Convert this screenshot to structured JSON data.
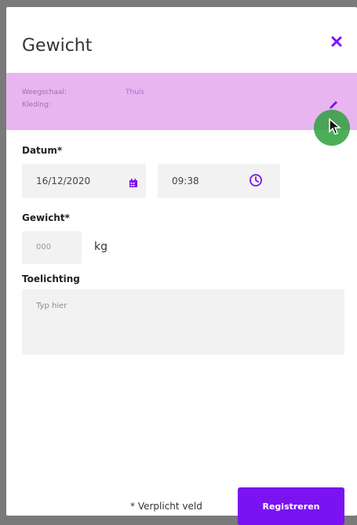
{
  "dialog": {
    "title": "Gewicht",
    "close_icon": "close-icon"
  },
  "info": {
    "scale_label": "Weegschaal:",
    "scale_value": "Thuis",
    "clothing_label": "Kleding:",
    "edit_icon": "pencil-icon"
  },
  "form": {
    "date_label": "Datum*",
    "date_value": "16/12/2020",
    "time_value": "09:38",
    "weight_label": "Gewicht*",
    "weight_placeholder": "000",
    "weight_unit": "kg",
    "note_label": "Toelichting",
    "note_placeholder": "Typ hier"
  },
  "footer": {
    "required_note": "* Verplicht veld",
    "register_label": "Registreren"
  },
  "colors": {
    "accent": "#7b12f2",
    "info_band": "#e8b5f0",
    "field_bg": "#f2f2f2"
  }
}
